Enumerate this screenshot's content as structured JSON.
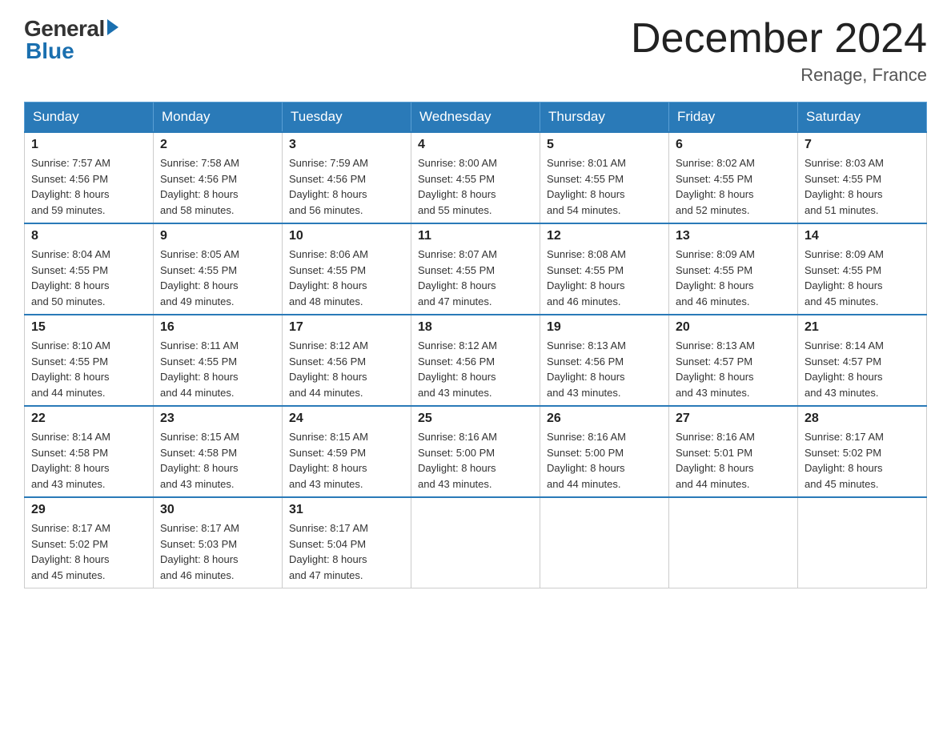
{
  "header": {
    "logo_general": "General",
    "logo_blue": "Blue",
    "title": "December 2024",
    "location": "Renage, France"
  },
  "days_of_week": [
    "Sunday",
    "Monday",
    "Tuesday",
    "Wednesday",
    "Thursday",
    "Friday",
    "Saturday"
  ],
  "weeks": [
    [
      {
        "day": 1,
        "sunrise": "7:57 AM",
        "sunset": "4:56 PM",
        "daylight": "8 hours and 59 minutes."
      },
      {
        "day": 2,
        "sunrise": "7:58 AM",
        "sunset": "4:56 PM",
        "daylight": "8 hours and 58 minutes."
      },
      {
        "day": 3,
        "sunrise": "7:59 AM",
        "sunset": "4:56 PM",
        "daylight": "8 hours and 56 minutes."
      },
      {
        "day": 4,
        "sunrise": "8:00 AM",
        "sunset": "4:55 PM",
        "daylight": "8 hours and 55 minutes."
      },
      {
        "day": 5,
        "sunrise": "8:01 AM",
        "sunset": "4:55 PM",
        "daylight": "8 hours and 54 minutes."
      },
      {
        "day": 6,
        "sunrise": "8:02 AM",
        "sunset": "4:55 PM",
        "daylight": "8 hours and 52 minutes."
      },
      {
        "day": 7,
        "sunrise": "8:03 AM",
        "sunset": "4:55 PM",
        "daylight": "8 hours and 51 minutes."
      }
    ],
    [
      {
        "day": 8,
        "sunrise": "8:04 AM",
        "sunset": "4:55 PM",
        "daylight": "8 hours and 50 minutes."
      },
      {
        "day": 9,
        "sunrise": "8:05 AM",
        "sunset": "4:55 PM",
        "daylight": "8 hours and 49 minutes."
      },
      {
        "day": 10,
        "sunrise": "8:06 AM",
        "sunset": "4:55 PM",
        "daylight": "8 hours and 48 minutes."
      },
      {
        "day": 11,
        "sunrise": "8:07 AM",
        "sunset": "4:55 PM",
        "daylight": "8 hours and 47 minutes."
      },
      {
        "day": 12,
        "sunrise": "8:08 AM",
        "sunset": "4:55 PM",
        "daylight": "8 hours and 46 minutes."
      },
      {
        "day": 13,
        "sunrise": "8:09 AM",
        "sunset": "4:55 PM",
        "daylight": "8 hours and 46 minutes."
      },
      {
        "day": 14,
        "sunrise": "8:09 AM",
        "sunset": "4:55 PM",
        "daylight": "8 hours and 45 minutes."
      }
    ],
    [
      {
        "day": 15,
        "sunrise": "8:10 AM",
        "sunset": "4:55 PM",
        "daylight": "8 hours and 44 minutes."
      },
      {
        "day": 16,
        "sunrise": "8:11 AM",
        "sunset": "4:55 PM",
        "daylight": "8 hours and 44 minutes."
      },
      {
        "day": 17,
        "sunrise": "8:12 AM",
        "sunset": "4:56 PM",
        "daylight": "8 hours and 44 minutes."
      },
      {
        "day": 18,
        "sunrise": "8:12 AM",
        "sunset": "4:56 PM",
        "daylight": "8 hours and 43 minutes."
      },
      {
        "day": 19,
        "sunrise": "8:13 AM",
        "sunset": "4:56 PM",
        "daylight": "8 hours and 43 minutes."
      },
      {
        "day": 20,
        "sunrise": "8:13 AM",
        "sunset": "4:57 PM",
        "daylight": "8 hours and 43 minutes."
      },
      {
        "day": 21,
        "sunrise": "8:14 AM",
        "sunset": "4:57 PM",
        "daylight": "8 hours and 43 minutes."
      }
    ],
    [
      {
        "day": 22,
        "sunrise": "8:14 AM",
        "sunset": "4:58 PM",
        "daylight": "8 hours and 43 minutes."
      },
      {
        "day": 23,
        "sunrise": "8:15 AM",
        "sunset": "4:58 PM",
        "daylight": "8 hours and 43 minutes."
      },
      {
        "day": 24,
        "sunrise": "8:15 AM",
        "sunset": "4:59 PM",
        "daylight": "8 hours and 43 minutes."
      },
      {
        "day": 25,
        "sunrise": "8:16 AM",
        "sunset": "5:00 PM",
        "daylight": "8 hours and 43 minutes."
      },
      {
        "day": 26,
        "sunrise": "8:16 AM",
        "sunset": "5:00 PM",
        "daylight": "8 hours and 44 minutes."
      },
      {
        "day": 27,
        "sunrise": "8:16 AM",
        "sunset": "5:01 PM",
        "daylight": "8 hours and 44 minutes."
      },
      {
        "day": 28,
        "sunrise": "8:17 AM",
        "sunset": "5:02 PM",
        "daylight": "8 hours and 45 minutes."
      }
    ],
    [
      {
        "day": 29,
        "sunrise": "8:17 AM",
        "sunset": "5:02 PM",
        "daylight": "8 hours and 45 minutes."
      },
      {
        "day": 30,
        "sunrise": "8:17 AM",
        "sunset": "5:03 PM",
        "daylight": "8 hours and 46 minutes."
      },
      {
        "day": 31,
        "sunrise": "8:17 AM",
        "sunset": "5:04 PM",
        "daylight": "8 hours and 47 minutes."
      },
      null,
      null,
      null,
      null
    ]
  ],
  "labels": {
    "sunrise": "Sunrise:",
    "sunset": "Sunset:",
    "daylight": "Daylight:"
  }
}
